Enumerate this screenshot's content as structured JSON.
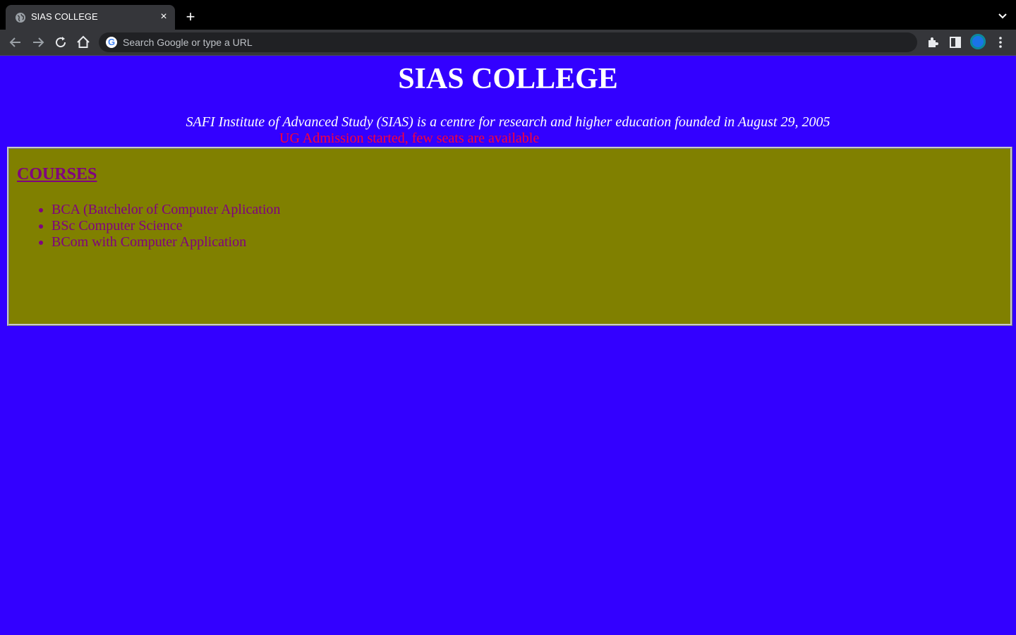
{
  "browser": {
    "tab_title": "SIAS COLLEGE",
    "close_symbol": "×",
    "new_tab_symbol": "+",
    "omnibox_placeholder": "Search Google or type a URL",
    "omnibox_value": "",
    "colors": {
      "tabbar": "#000000",
      "toolbar": "#35363a",
      "omnibox": "#202124"
    }
  },
  "page": {
    "title": "SIAS COLLEGE",
    "tagline": "SAFI Institute of Advanced Study (SIAS) is a centre for research and higher education founded in August 29, 2005",
    "announcement": "UG Admission started, few seats are available",
    "courses": {
      "heading": "COURSES",
      "items": [
        "BCA (Batchelor of Computer Aplication",
        "BSc Computer Science",
        "BCom with Computer Application"
      ]
    },
    "colors": {
      "background": "#3300ff",
      "title": "#ffffff",
      "announcement": "#ff0033",
      "courses_box": "#808000",
      "courses_text": "#800080"
    }
  },
  "icons": {
    "favicon": "globe-icon",
    "back": "arrow-left-icon",
    "forward": "arrow-right-icon",
    "reload": "reload-icon",
    "home": "home-icon",
    "search_engine": "google-g-icon",
    "extensions": "puzzle-icon",
    "side_panel": "side-panel-icon",
    "profile": "avatar",
    "menu": "kebab-menu-icon",
    "tab_search": "chevron-down-icon"
  }
}
